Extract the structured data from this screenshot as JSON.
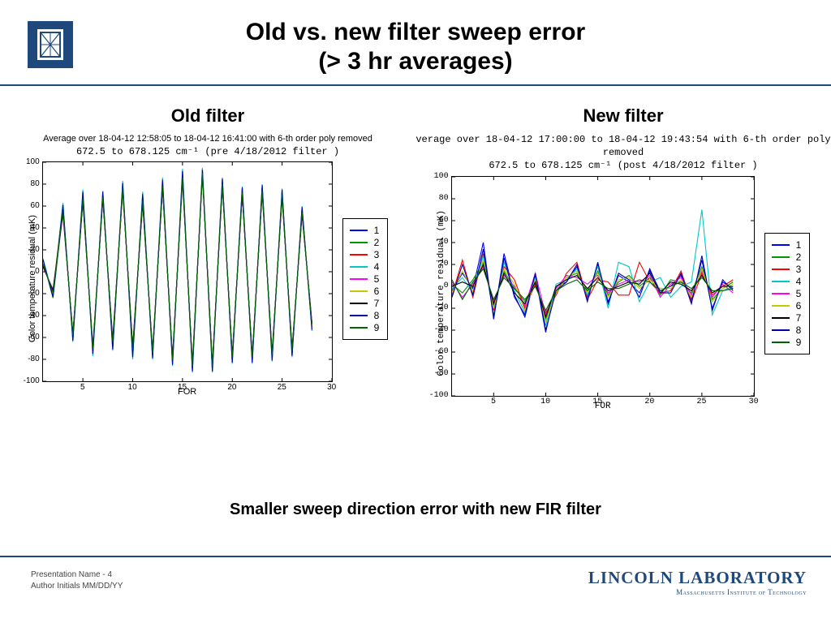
{
  "title_l1": "Old vs. new filter sweep error",
  "title_l2": "(> 3 hr averages)",
  "conclusion": "Smaller sweep direction error with new FIR filter",
  "footer": {
    "l1": "Presentation Name - 4",
    "l2": "Author Initials  MM/DD/YY"
  },
  "lab": {
    "l1": "LINCOLN LABORATORY",
    "l2": "Massachusetts Institute of Technology"
  },
  "legend_labels": [
    "1",
    "2",
    "3",
    "4",
    "5",
    "6",
    "7",
    "8",
    "9"
  ],
  "series_colors": [
    "#0000ff",
    "#009600",
    "#ff0000",
    "#00c8c8",
    "#ff00ff",
    "#c8c800",
    "#000000",
    "#0000aa",
    "#006400"
  ],
  "left": {
    "heading": "Old  filter",
    "caption1": "Average over 18-04-12 12:58:05 to 18-04-12 16:41:00 with 6-th order poly removed",
    "caption2": "672.5 to 678.125 cm⁻¹   (pre 4/18/2012 filter )",
    "xlabel": "FOR"
  },
  "right": {
    "heading": "New  filter",
    "caption1": "verage over 18-04-12 17:00:00 to 18-04-12 19:43:54 with 6-th order poly removed",
    "caption2": "672.5 to 678.125 cm⁻¹   (post 4/18/2012 filter )",
    "xlabel": "FOR"
  },
  "ylabel": "Color temperature residual (mK)",
  "chart_data": [
    {
      "type": "line",
      "title": "Old filter — pre 4/18/2012",
      "xlabel": "FOR",
      "ylabel": "Color temperature residual (mK)",
      "xlim": [
        1,
        30
      ],
      "ylim": [
        -100,
        100
      ],
      "x": [
        1,
        2,
        3,
        4,
        5,
        6,
        7,
        8,
        9,
        10,
        11,
        12,
        13,
        14,
        15,
        16,
        17,
        18,
        19,
        20,
        21,
        22,
        23,
        24,
        25,
        26,
        27,
        28
      ],
      "series": [
        {
          "name": "1",
          "values": [
            8,
            -20,
            58,
            -60,
            70,
            -72,
            70,
            -68,
            78,
            -74,
            68,
            -76,
            80,
            -82,
            88,
            -88,
            92,
            -88,
            82,
            -80,
            74,
            -80,
            76,
            -78,
            72,
            -74,
            56,
            -50
          ]
        },
        {
          "name": "2",
          "values": [
            10,
            -24,
            55,
            -58,
            66,
            -70,
            68,
            -65,
            76,
            -70,
            64,
            -74,
            78,
            -80,
            85,
            -85,
            90,
            -86,
            80,
            -78,
            72,
            -78,
            74,
            -76,
            70,
            -72,
            54,
            -48
          ]
        },
        {
          "name": "3",
          "values": [
            6,
            -18,
            60,
            -62,
            72,
            -74,
            72,
            -70,
            80,
            -76,
            70,
            -78,
            82,
            -84,
            90,
            -90,
            94,
            -90,
            84,
            -82,
            76,
            -82,
            78,
            -80,
            74,
            -76,
            58,
            -52
          ]
        },
        {
          "name": "4",
          "values": [
            12,
            -22,
            63,
            -64,
            75,
            -77,
            74,
            -72,
            83,
            -80,
            73,
            -80,
            86,
            -86,
            94,
            -92,
            95,
            -92,
            86,
            -84,
            78,
            -84,
            80,
            -82,
            76,
            -78,
            60,
            -54
          ]
        },
        {
          "name": "5",
          "values": [
            4,
            -16,
            52,
            -56,
            64,
            -68,
            66,
            -62,
            74,
            -68,
            62,
            -72,
            76,
            -78,
            84,
            -84,
            88,
            -84,
            78,
            -76,
            70,
            -76,
            72,
            -74,
            68,
            -70,
            52,
            -46
          ]
        },
        {
          "name": "6",
          "values": [
            9,
            -21,
            57,
            -59,
            68,
            -71,
            69,
            -66,
            77,
            -72,
            66,
            -75,
            79,
            -81,
            87,
            -87,
            91,
            -87,
            81,
            -79,
            73,
            -79,
            75,
            -77,
            71,
            -73,
            55,
            -49
          ]
        },
        {
          "name": "7",
          "values": [
            5,
            -17,
            54,
            -57,
            65,
            -69,
            67,
            -63,
            75,
            -69,
            63,
            -73,
            77,
            -79,
            85,
            -85,
            89,
            -85,
            79,
            -77,
            71,
            -77,
            73,
            -75,
            69,
            -71,
            53,
            -47
          ]
        },
        {
          "name": "8",
          "values": [
            11,
            -23,
            61,
            -63,
            73,
            -75,
            73,
            -71,
            81,
            -78,
            71,
            -79,
            84,
            -85,
            92,
            -91,
            93,
            -91,
            85,
            -83,
            77,
            -83,
            79,
            -81,
            75,
            -77,
            59,
            -53
          ]
        },
        {
          "name": "9",
          "values": [
            7,
            -19,
            56,
            -58,
            67,
            -70,
            68,
            -64,
            76,
            -71,
            65,
            -74,
            78,
            -80,
            86,
            -86,
            90,
            -86,
            80,
            -78,
            72,
            -78,
            74,
            -76,
            70,
            -72,
            54,
            -48
          ]
        }
      ]
    },
    {
      "type": "line",
      "title": "New filter — post 4/18/2012",
      "xlabel": "FOR",
      "ylabel": "Color temperature residual (mK)",
      "xlim": [
        1,
        30
      ],
      "ylim": [
        -100,
        100
      ],
      "x": [
        1,
        2,
        3,
        4,
        5,
        6,
        7,
        8,
        9,
        10,
        11,
        12,
        13,
        14,
        15,
        16,
        17,
        18,
        19,
        20,
        21,
        22,
        23,
        24,
        25,
        26,
        27,
        28
      ],
      "series": [
        {
          "name": "1",
          "values": [
            -4,
            12,
            -2,
            40,
            -30,
            30,
            -8,
            -28,
            10,
            -42,
            0,
            4,
            18,
            -10,
            20,
            -14,
            10,
            4,
            -6,
            14,
            -4,
            0,
            10,
            -12,
            24,
            -20,
            4,
            -2
          ]
        },
        {
          "name": "2",
          "values": [
            2,
            -6,
            6,
            22,
            -18,
            14,
            -2,
            -14,
            4,
            -30,
            -4,
            8,
            12,
            -4,
            14,
            -8,
            4,
            10,
            0,
            8,
            -8,
            6,
            4,
            -6,
            18,
            -12,
            -2,
            4
          ]
        },
        {
          "name": "3",
          "values": [
            -8,
            24,
            -10,
            30,
            -22,
            18,
            6,
            -20,
            2,
            -24,
            -8,
            12,
            22,
            -12,
            6,
            4,
            -8,
            -8,
            22,
            4,
            -6,
            -4,
            14,
            -14,
            12,
            -8,
            0,
            6
          ]
        },
        {
          "name": "4",
          "values": [
            -2,
            8,
            -6,
            28,
            -26,
            22,
            -4,
            -24,
            8,
            -36,
            2,
            6,
            16,
            -8,
            18,
            -20,
            22,
            18,
            -14,
            4,
            8,
            -10,
            0,
            4,
            70,
            -26,
            -4,
            0
          ]
        },
        {
          "name": "5",
          "values": [
            4,
            -10,
            2,
            18,
            -14,
            10,
            0,
            -18,
            12,
            -26,
            -2,
            10,
            8,
            2,
            10,
            -6,
            2,
            6,
            4,
            10,
            -10,
            2,
            8,
            -8,
            14,
            -10,
            2,
            -6
          ]
        },
        {
          "name": "6",
          "values": [
            -6,
            14,
            -4,
            24,
            -20,
            16,
            2,
            -22,
            6,
            -32,
            -6,
            8,
            14,
            -6,
            12,
            -10,
            6,
            8,
            -2,
            6,
            -2,
            -2,
            6,
            -10,
            16,
            -14,
            -2,
            2
          ]
        },
        {
          "name": "7",
          "values": [
            0,
            4,
            0,
            20,
            -16,
            12,
            -6,
            -16,
            4,
            -28,
            0,
            6,
            10,
            -2,
            8,
            -4,
            0,
            4,
            2,
            12,
            -6,
            4,
            2,
            -4,
            10,
            -6,
            0,
            0
          ]
        },
        {
          "name": "8",
          "values": [
            -10,
            20,
            -8,
            34,
            -28,
            26,
            -10,
            -26,
            12,
            -40,
            -4,
            4,
            20,
            -14,
            22,
            -16,
            12,
            6,
            -10,
            16,
            -6,
            -6,
            12,
            -16,
            28,
            -22,
            6,
            -4
          ]
        },
        {
          "name": "9",
          "values": [
            6,
            -12,
            4,
            16,
            -12,
            8,
            -2,
            -12,
            0,
            -22,
            -4,
            2,
            6,
            -4,
            4,
            -2,
            -2,
            2,
            6,
            4,
            -4,
            0,
            4,
            -2,
            8,
            -4,
            -4,
            -2
          ]
        }
      ]
    }
  ]
}
